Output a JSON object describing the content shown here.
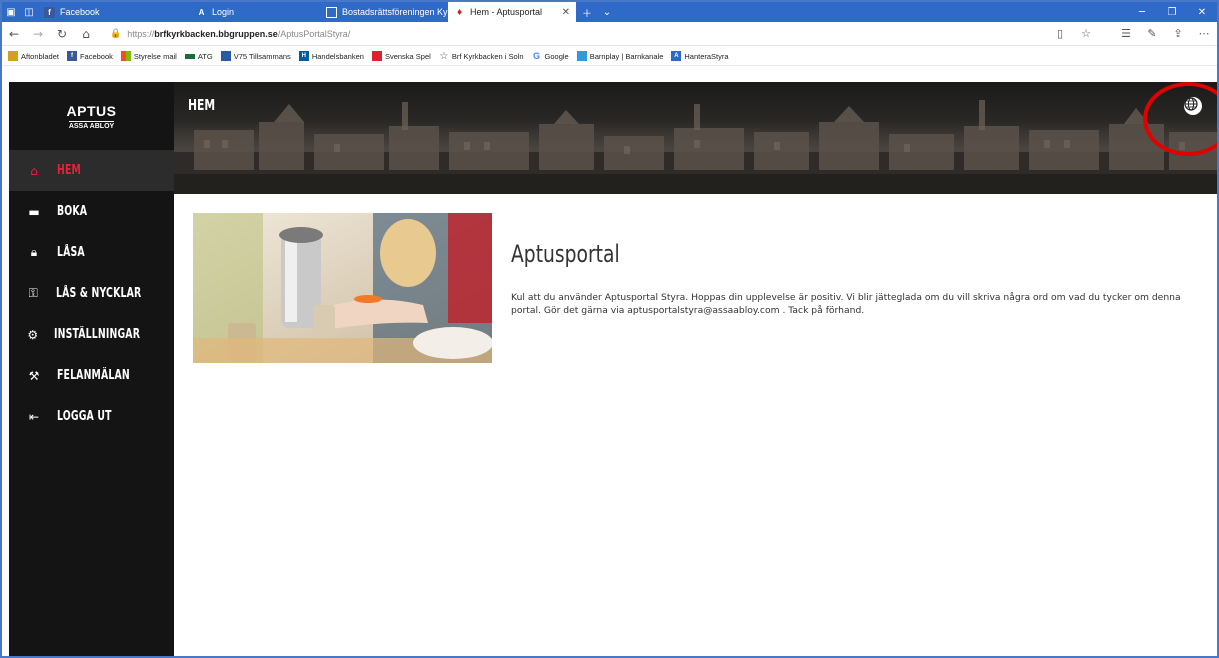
{
  "browser": {
    "tabs": [
      {
        "label": "Facebook",
        "icon": "facebook-icon",
        "active": false
      },
      {
        "label": "Login",
        "icon": "aptus-icon",
        "active": false
      },
      {
        "label": "Bostadsrättsföreningen Kyrl",
        "icon": "page-icon",
        "active": false
      },
      {
        "label": "Hem - Aptusportal",
        "icon": "pin-icon",
        "active": true
      }
    ],
    "url_scheme": "https://",
    "url_host": "brfkyrkbacken.bbgruppen.se",
    "url_path": "/AptusPortalStyra/",
    "bookmarks": [
      {
        "label": "Aftonbladet",
        "color": "#d4a020"
      },
      {
        "label": "Facebook",
        "color": "#3b5998"
      },
      {
        "label": "Styrelse mail",
        "color": "#f0a010"
      },
      {
        "label": "ATG",
        "color": "#1d6a3a"
      },
      {
        "label": "V75 Tillsammans",
        "color": "#2a5aa0"
      },
      {
        "label": "Handelsbanken",
        "color": "#005aa0"
      },
      {
        "label": "Svenska Spel",
        "color": "#e0202a"
      },
      {
        "label": "Brf Kyrkbacken i Soln",
        "color": "#555555"
      },
      {
        "label": "Google",
        "color": "#4285f4"
      },
      {
        "label": "Barnplay | Barnkanale",
        "color": "#3399dd"
      },
      {
        "label": "HanteraStyra",
        "color": "#2a6ac0"
      }
    ]
  },
  "sidebar": {
    "logo_main": "APTUS",
    "logo_sub": "ASSA ABLOY",
    "items": [
      {
        "label": "HEM",
        "icon": "home-icon",
        "active": true
      },
      {
        "label": "BOKA",
        "icon": "calendar-icon",
        "active": false
      },
      {
        "label": "LÅSA",
        "icon": "lock-icon",
        "active": false
      },
      {
        "label": "LÅS & NYCKLAR",
        "icon": "key-icon",
        "active": false
      },
      {
        "label": "INSTÄLLNINGAR",
        "icon": "gear-icon",
        "active": false
      },
      {
        "label": "FELANMÄLAN",
        "icon": "tools-icon",
        "active": false
      },
      {
        "label": "LOGGA UT",
        "icon": "logout-icon",
        "active": false
      }
    ]
  },
  "header": {
    "title": "HEM"
  },
  "content": {
    "title": "Aptusportal",
    "body": "Kul att du använder Aptusportal Styra. Hoppas din upplevelse är positiv. Vi blir jätteglada om du vill skriva några ord om vad du tycker om denna portal. Gör det gärna via aptusportalstyra@assaabloy.com . Tack på förhand."
  },
  "colors": {
    "accent": "#e3223b",
    "sidebar_bg": "#141414",
    "highlight_circle": "#e00000",
    "browser_blue": "#2f6ac9"
  }
}
